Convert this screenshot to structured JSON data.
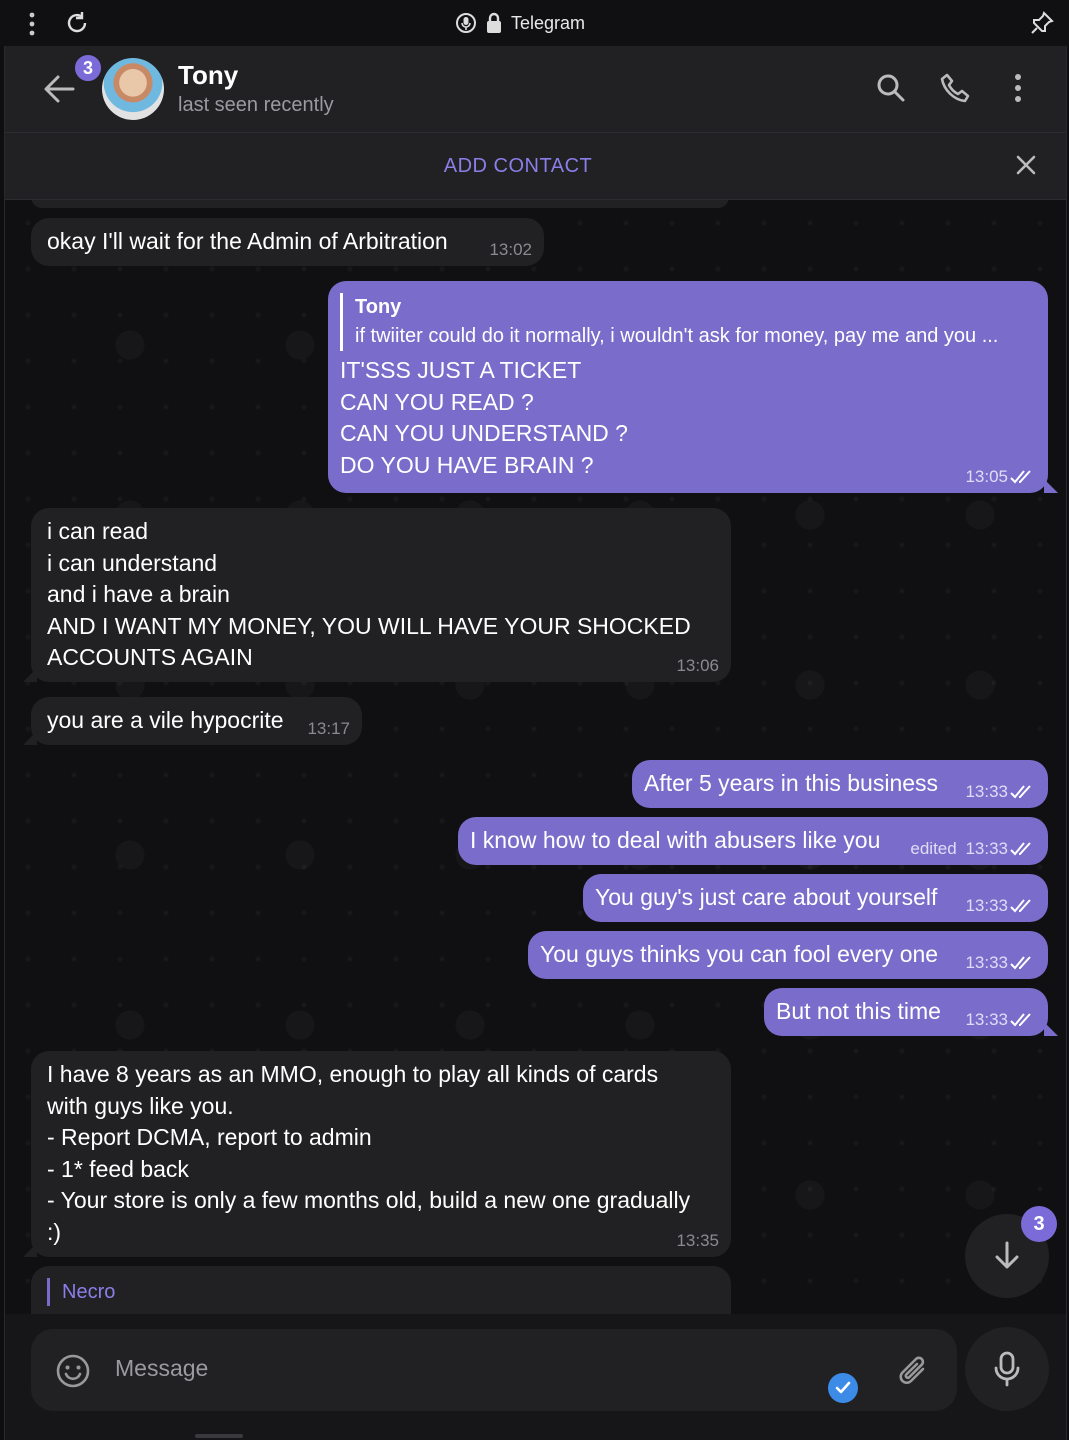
{
  "browser": {
    "title": "Telegram"
  },
  "header": {
    "name": "Tony",
    "status": "last seen recently",
    "unread_badge": "3"
  },
  "add_contact": {
    "label": "ADD CONTACT"
  },
  "messages": [
    {
      "dir": "in",
      "lines": [
        "okay I'll wait for the Admin of Arbitration"
      ],
      "time": "13:02"
    },
    {
      "dir": "out",
      "reply_name": "Tony",
      "reply_text": "if twiiter could do it normally, i wouldn't ask for money, pay me and you ...",
      "lines": [
        "IT'SSS JUST A TICKET",
        "CAN YOU READ ?",
        "CAN YOU UNDERSTAND ?",
        "DO YOU HAVE BRAIN ?"
      ],
      "time": "13:05"
    },
    {
      "dir": "in",
      "lines": [
        "i can read",
        "i can understand",
        "and i have a brain",
        "AND I WANT MY MONEY, YOU WILL HAVE YOUR SHOCKED",
        "ACCOUNTS AGAIN"
      ],
      "time": "13:06"
    },
    {
      "dir": "in",
      "lines": [
        "you are a vile hypocrite"
      ],
      "time": "13:17"
    },
    {
      "dir": "out",
      "lines": [
        "After 5 years in this business"
      ],
      "time": "13:33"
    },
    {
      "dir": "out",
      "lines": [
        "I know how to deal with abusers like you"
      ],
      "time": "13:33",
      "edited": "edited"
    },
    {
      "dir": "out",
      "lines": [
        "You guy's just care about yourself"
      ],
      "time": "13:33"
    },
    {
      "dir": "out",
      "lines": [
        "You guys thinks you can fool every one"
      ],
      "time": "13:33"
    },
    {
      "dir": "out",
      "lines": [
        "But not this time"
      ],
      "time": "13:33"
    },
    {
      "dir": "in",
      "lines": [
        "I have 8 years as an MMO, enough to play all kinds of cards",
        "with guys like you.",
        "- Report DCMA, report to admin",
        "- 1* feed back",
        "- Your store is only a few months old, build a new one gradually",
        ":)"
      ],
      "time": "13:35"
    },
    {
      "dir": "in",
      "reply_name": "Necro"
    }
  ],
  "scroll_badge": "3",
  "composer": {
    "placeholder": "Message"
  },
  "colors": {
    "accent": "#7a6cca",
    "incoming": "#212123",
    "background": "#101012",
    "check": "#3c8ce7"
  }
}
